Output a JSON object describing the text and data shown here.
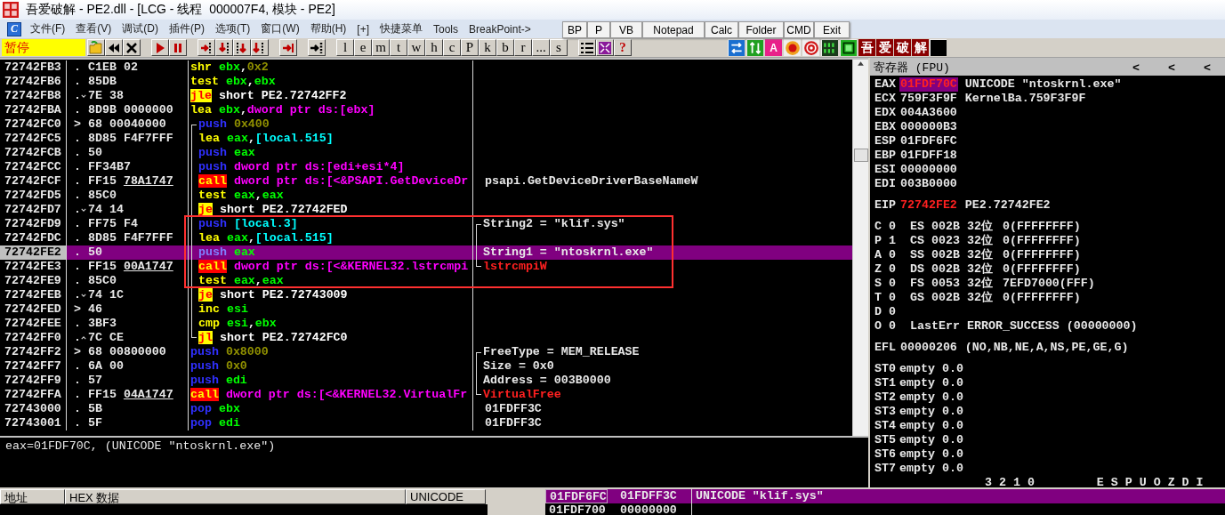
{
  "window": {
    "title": "吾爱破解 - PE2.dll - [LCG - 线程  000007F4, 模块 - PE2]"
  },
  "menu": {
    "logo": "C",
    "items": [
      "文件(F)",
      "查看(V)",
      "调试(D)",
      "插件(P)",
      "选项(T)",
      "窗口(W)",
      "帮助(H)",
      "[+]",
      "快捷菜单",
      "Tools",
      "BreakPoint->"
    ]
  },
  "quick_toolbar": [
    "BP",
    "P",
    "VB",
    "Notepad",
    "Calc",
    "Folder",
    "CMD",
    "Exit"
  ],
  "toolbar": {
    "status": "暂停",
    "letter_buttons": [
      "l",
      "e",
      "m",
      "t",
      "w",
      "h",
      "c",
      "P",
      "k",
      "b",
      "r",
      "...",
      "s"
    ],
    "help": "?",
    "text_button": "A",
    "plugin_buttons": [
      "吾",
      "爱",
      "破",
      "解"
    ]
  },
  "disassembly": {
    "rows": [
      {
        "address": "72742FB3",
        "marker": ".",
        "hex": "C1EB 02",
        "selected": false,
        "code": [
          {
            "kind": "op",
            "text": "shr"
          },
          {
            "kind": "reg",
            "text": " ebx"
          },
          {
            "kind": "txt",
            "text": ","
          },
          {
            "kind": "imm",
            "text": "0x2"
          }
        ]
      },
      {
        "address": "72742FB6",
        "marker": ".",
        "hex": "85DB",
        "selected": false,
        "code": [
          {
            "kind": "op",
            "text": "test"
          },
          {
            "kind": "reg",
            "text": " ebx"
          },
          {
            "kind": "txt",
            "text": ","
          },
          {
            "kind": "reg",
            "text": "ebx"
          }
        ]
      },
      {
        "address": "72742FB8",
        "marker": ".",
        "arrow": {
          "kind": "down"
        },
        "hex": "7E 38",
        "selected": false,
        "code": [
          {
            "kind": "jump",
            "text": "jle"
          },
          {
            "kind": "txt",
            "text": " short PE2.72742FF2"
          }
        ]
      },
      {
        "address": "72742FBA",
        "marker": ".",
        "hex": "8D9B 0000000",
        "selected": false,
        "code": [
          {
            "kind": "op",
            "text": "lea"
          },
          {
            "kind": "reg",
            "text": " ebx"
          },
          {
            "kind": "txt",
            "text": ","
          },
          {
            "kind": "mem",
            "text": "dword ptr ds:[ebx]"
          }
        ]
      },
      {
        "address": "72742FC0",
        "marker": ">",
        "hex": "68 00040000",
        "selected": false,
        "bracket": {
          "kind": "start"
        },
        "code": [
          {
            "kind": "push",
            "text": "push"
          },
          {
            "kind": "imm",
            "text": " 0x400"
          }
        ]
      },
      {
        "address": "72742FC5",
        "marker": ".",
        "hex": "8D85 F4F7FFF",
        "selected": false,
        "bracket": {
          "kind": "mid"
        },
        "code": [
          {
            "kind": "op",
            "text": "lea"
          },
          {
            "kind": "reg",
            "text": " eax"
          },
          {
            "kind": "txt",
            "text": ","
          },
          {
            "kind": "loc",
            "text": "[local.515]"
          }
        ]
      },
      {
        "address": "72742FCB",
        "marker": ".",
        "hex": "50",
        "selected": false,
        "bracket": {
          "kind": "mid"
        },
        "code": [
          {
            "kind": "push",
            "text": "push"
          },
          {
            "kind": "reg",
            "text": " eax"
          }
        ]
      },
      {
        "address": "72742FCC",
        "marker": ".",
        "hex": "FF34B7",
        "selected": false,
        "bracket": {
          "kind": "mid"
        },
        "code": [
          {
            "kind": "push",
            "text": "push"
          },
          {
            "kind": "mem",
            "text": " dword ptr ds:[edi+esi*4]"
          }
        ]
      },
      {
        "address": "72742FCF",
        "marker": ".",
        "hex": "FF15",
        "hex_link": "78A1747",
        "selected": false,
        "bracket": {
          "kind": "mid"
        },
        "code": [
          {
            "kind": "call",
            "text": "call"
          },
          {
            "kind": "mem",
            "text": " dword ptr ds:[<&PSAPI.GetDeviceDr"
          }
        ],
        "comment": {
          "kind": "plain",
          "text": "psapi.GetDeviceDriverBaseNameW"
        }
      },
      {
        "address": "72742FD5",
        "marker": ".",
        "hex": "85C0",
        "selected": false,
        "bracket": {
          "kind": "mid"
        },
        "code": [
          {
            "kind": "op",
            "text": "test"
          },
          {
            "kind": "reg",
            "text": " eax"
          },
          {
            "kind": "txt",
            "text": ","
          },
          {
            "kind": "reg",
            "text": "eax"
          }
        ]
      },
      {
        "address": "72742FD7",
        "marker": ".",
        "arrow": {
          "kind": "down"
        },
        "hex": "74 14",
        "selected": false,
        "bracket": {
          "kind": "mid"
        },
        "code": [
          {
            "kind": "jump",
            "text": "je"
          },
          {
            "kind": "txt",
            "text": " short PE2.72742FED"
          }
        ]
      },
      {
        "address": "72742FD9",
        "marker": ".",
        "hex": "FF75 F4",
        "selected": false,
        "bracket": {
          "kind": "mid"
        },
        "code": [
          {
            "kind": "push",
            "text": "push"
          },
          {
            "kind": "loc",
            "text": " [local.3]"
          }
        ],
        "comment": {
          "kind": "plain",
          "text": "String2 = \"klif.sys\""
        },
        "comment_bracket": {
          "kind": "start"
        }
      },
      {
        "address": "72742FDC",
        "marker": ".",
        "hex": "8D85 F4F7FFF",
        "selected": false,
        "bracket": {
          "kind": "mid"
        },
        "code": [
          {
            "kind": "op",
            "text": "lea"
          },
          {
            "kind": "reg",
            "text": " eax"
          },
          {
            "kind": "txt",
            "text": ","
          },
          {
            "kind": "loc",
            "text": "[local.515]"
          }
        ],
        "comment_bracket": {
          "kind": "mid"
        }
      },
      {
        "address": "72742FE2",
        "marker": ".",
        "hex": "50",
        "selected": true,
        "bracket": {
          "kind": "mid"
        },
        "code": [
          {
            "kind": "push",
            "text": "push"
          },
          {
            "kind": "reg",
            "text": " eax"
          }
        ],
        "comment": {
          "kind": "plain",
          "text": "String1 = \"ntoskrnl.exe\""
        },
        "comment_bracket": {
          "kind": "mid"
        }
      },
      {
        "address": "72742FE3",
        "marker": ".",
        "hex": "FF15",
        "hex_link": "00A1747",
        "selected": false,
        "bracket": {
          "kind": "mid"
        },
        "code": [
          {
            "kind": "call",
            "text": "call"
          },
          {
            "kind": "mem",
            "text": " dword ptr ds:[<&KERNEL32.lstrcmpi"
          }
        ],
        "comment": {
          "kind": "api",
          "text": "lstrcmpiW"
        },
        "comment_bracket": {
          "kind": "end"
        }
      },
      {
        "address": "72742FE9",
        "marker": ".",
        "hex": "85C0",
        "selected": false,
        "bracket": {
          "kind": "mid"
        },
        "code": [
          {
            "kind": "op",
            "text": "test"
          },
          {
            "kind": "reg",
            "text": " eax"
          },
          {
            "kind": "txt",
            "text": ","
          },
          {
            "kind": "reg",
            "text": "eax"
          }
        ]
      },
      {
        "address": "72742FEB",
        "marker": ".",
        "arrow": {
          "kind": "down"
        },
        "hex": "74 1C",
        "selected": false,
        "bracket": {
          "kind": "mid"
        },
        "code": [
          {
            "kind": "jump",
            "text": "je"
          },
          {
            "kind": "txt",
            "text": " short PE2.72743009"
          }
        ]
      },
      {
        "address": "72742FED",
        "marker": ">",
        "hex": "46",
        "selected": false,
        "bracket": {
          "kind": "mid"
        },
        "code": [
          {
            "kind": "op",
            "text": "inc"
          },
          {
            "kind": "reg",
            "text": " esi"
          }
        ]
      },
      {
        "address": "72742FEE",
        "marker": ".",
        "hex": "3BF3",
        "selected": false,
        "bracket": {
          "kind": "mid"
        },
        "code": [
          {
            "kind": "op",
            "text": "cmp"
          },
          {
            "kind": "reg",
            "text": " esi"
          },
          {
            "kind": "txt",
            "text": ","
          },
          {
            "kind": "reg",
            "text": "ebx"
          }
        ]
      },
      {
        "address": "72742FF0",
        "marker": ".",
        "arrow": {
          "kind": "up"
        },
        "hex": "7C CE",
        "selected": false,
        "bracket": {
          "kind": "end"
        },
        "code": [
          {
            "kind": "jump",
            "text": "jl"
          },
          {
            "kind": "txt",
            "text": " short PE2.72742FC0"
          }
        ]
      },
      {
        "address": "72742FF2",
        "marker": ">",
        "hex": "68 00800000",
        "selected": false,
        "code": [
          {
            "kind": "push",
            "text": "push"
          },
          {
            "kind": "imm",
            "text": " 0x8000"
          }
        ],
        "comment": {
          "kind": "plain",
          "text": "FreeType = MEM_RELEASE"
        },
        "comment_bracket": {
          "kind": "start"
        }
      },
      {
        "address": "72742FF7",
        "marker": ".",
        "hex": "6A 00",
        "selected": false,
        "code": [
          {
            "kind": "push",
            "text": "push"
          },
          {
            "kind": "imm",
            "text": " 0x0"
          }
        ],
        "comment": {
          "kind": "plain",
          "text": "Size = 0x0"
        },
        "comment_bracket": {
          "kind": "mid"
        }
      },
      {
        "address": "72742FF9",
        "marker": ".",
        "hex": "57",
        "selected": false,
        "code": [
          {
            "kind": "push",
            "text": "push"
          },
          {
            "kind": "reg",
            "text": " edi"
          }
        ],
        "comment": {
          "kind": "plain",
          "text": "Address = 003B0000"
        },
        "comment_bracket": {
          "kind": "mid"
        }
      },
      {
        "address": "72742FFA",
        "marker": ".",
        "hex": "FF15",
        "hex_link": "04A1747",
        "selected": false,
        "code": [
          {
            "kind": "call",
            "text": "call"
          },
          {
            "kind": "mem",
            "text": " dword ptr ds:[<&KERNEL32.VirtualFr"
          }
        ],
        "comment": {
          "kind": "api",
          "text": "VirtualFree"
        },
        "comment_bracket": {
          "kind": "end"
        }
      },
      {
        "address": "72743000",
        "marker": ".",
        "hex": "5B",
        "selected": false,
        "code": [
          {
            "kind": "push",
            "text": "pop"
          },
          {
            "kind": "reg",
            "text": " ebx"
          }
        ],
        "comment": {
          "kind": "plain",
          "text": "01FDFF3C"
        }
      },
      {
        "address": "72743001",
        "marker": ".",
        "hex": "5F",
        "selected": false,
        "code": [
          {
            "kind": "push",
            "text": "pop"
          },
          {
            "kind": "reg",
            "text": " edi"
          }
        ],
        "comment": {
          "kind": "plain",
          "text": "01FDFF3C"
        }
      }
    ]
  },
  "registers": {
    "title": "寄存器 (FPU)",
    "nav": [
      "<",
      "<",
      "<"
    ],
    "general": [
      {
        "name": "EAX",
        "value": "01FDF70C",
        "changed": true,
        "selected": true,
        "comment": "UNICODE \"ntoskrnl.exe\""
      },
      {
        "name": "ECX",
        "value": "759F3F9F",
        "changed": false,
        "selected": false,
        "comment": "KernelBa.759F3F9F"
      },
      {
        "name": "EDX",
        "value": "004A3600",
        "changed": false,
        "selected": false
      },
      {
        "name": "EBX",
        "value": "000000B3",
        "changed": false,
        "selected": false
      },
      {
        "name": "ESP",
        "value": "01FDF6FC",
        "changed": false,
        "selected": false
      },
      {
        "name": "EBP",
        "value": "01FDFF18",
        "changed": false,
        "selected": false
      },
      {
        "name": "ESI",
        "value": "00000000",
        "changed": false,
        "selected": false
      },
      {
        "name": "EDI",
        "value": "003B0000",
        "changed": false,
        "selected": false
      }
    ],
    "eip": {
      "name": "EIP",
      "value": "72742FE2",
      "changed": true,
      "selected": false,
      "comment": "PE2.72742FE2"
    },
    "flags": [
      {
        "flag": "C",
        "value": "0",
        "segment": {
          "name": "ES",
          "selector": "002B",
          "bits": "32位",
          "base": "0(FFFFFFFF)"
        }
      },
      {
        "flag": "P",
        "value": "1",
        "segment": {
          "name": "CS",
          "selector": "0023",
          "bits": "32位",
          "base": "0(FFFFFFFF)"
        }
      },
      {
        "flag": "A",
        "value": "0",
        "segment": {
          "name": "SS",
          "selector": "002B",
          "bits": "32位",
          "base": "0(FFFFFFFF)"
        }
      },
      {
        "flag": "Z",
        "value": "0",
        "segment": {
          "name": "DS",
          "selector": "002B",
          "bits": "32位",
          "base": "0(FFFFFFFF)"
        }
      },
      {
        "flag": "S",
        "value": "0",
        "segment": {
          "name": "FS",
          "selector": "0053",
          "bits": "32位",
          "base": "7EFD7000(FFF)"
        }
      },
      {
        "flag": "T",
        "value": "0",
        "segment": {
          "name": "GS",
          "selector": "002B",
          "bits": "32位",
          "base": "0(FFFFFFFF)"
        }
      },
      {
        "flag": "D",
        "value": "0"
      },
      {
        "flag": "O",
        "value": "0",
        "last_error": {
          "label": "LastErr",
          "text": "ERROR_SUCCESS (00000000)"
        }
      }
    ],
    "efl": {
      "label": "EFL",
      "value": "00000206",
      "decoded": "(NO,NB,NE,A,NS,PE,GE,G)"
    },
    "fpu": [
      {
        "name": "ST0",
        "tag": "empty",
        "value": "0.0"
      },
      {
        "name": "ST1",
        "tag": "empty",
        "value": "0.0"
      },
      {
        "name": "ST2",
        "tag": "empty",
        "value": "0.0"
      },
      {
        "name": "ST3",
        "tag": "empty",
        "value": "0.0"
      },
      {
        "name": "ST4",
        "tag": "empty",
        "value": "0.0"
      },
      {
        "name": "ST5",
        "tag": "empty",
        "value": "0.0"
      },
      {
        "name": "ST6",
        "tag": "empty",
        "value": "0.0"
      },
      {
        "name": "ST7",
        "tag": "empty",
        "value": "0.0"
      }
    ],
    "footer": [
      "3 2 1 0",
      "E S P U O Z D I"
    ]
  },
  "info": "eax=01FDF70C, (UNICODE \"ntoskrnl.exe\")",
  "dump": {
    "columns": [
      "地址",
      "HEX 数据",
      "UNICODE"
    ]
  },
  "stack": {
    "rows": [
      {
        "address": "01FDF6FC",
        "value": "01FDFF3C",
        "comment": "UNICODE \"klif.sys\"",
        "selected": true
      },
      {
        "address": "01FDF700",
        "value": "00000000",
        "selected": false
      }
    ]
  }
}
